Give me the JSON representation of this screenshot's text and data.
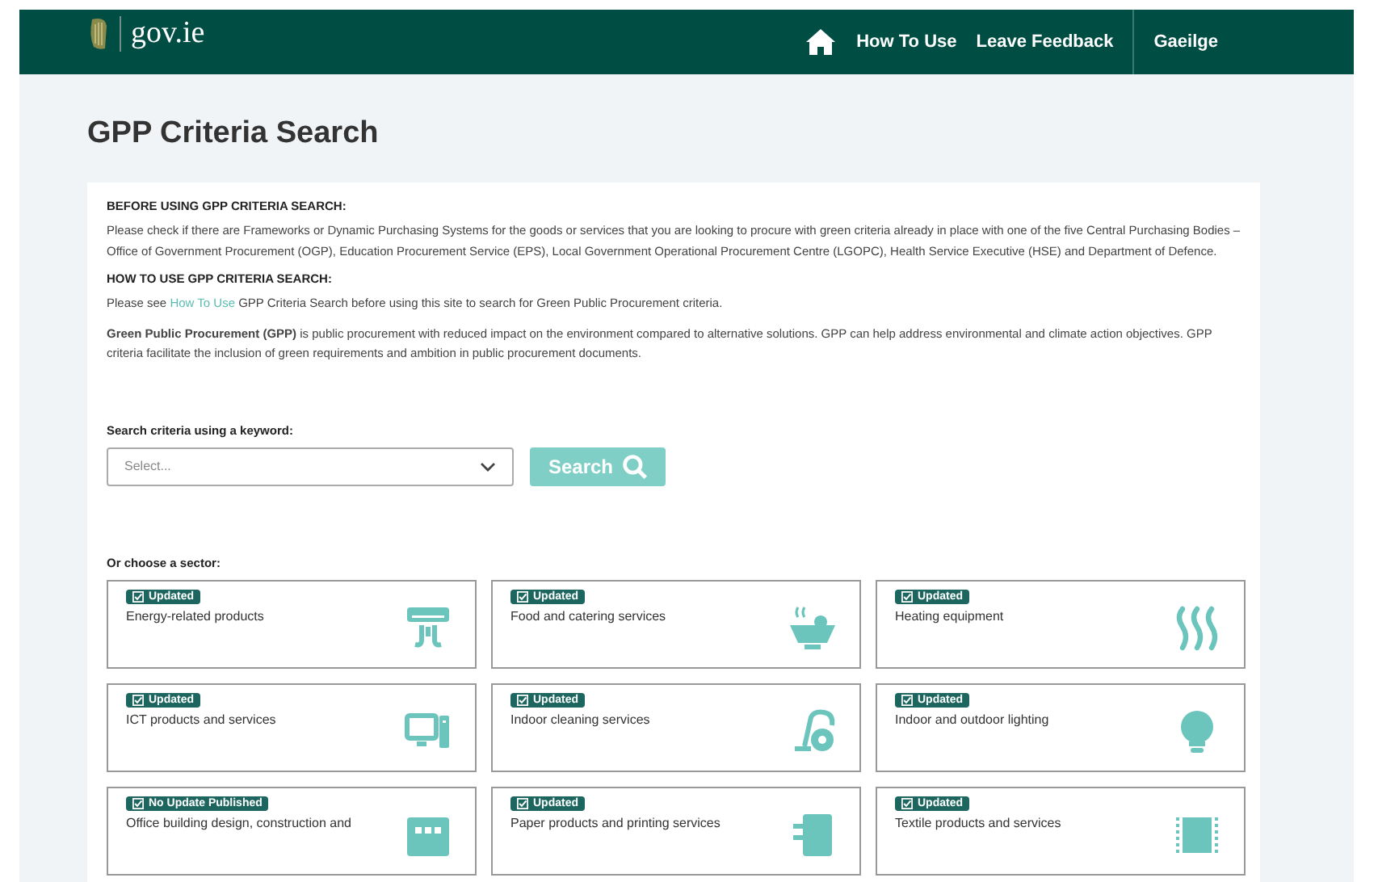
{
  "header": {
    "logo": "gov.ie",
    "nav": [
      "How To Use",
      "Leave Feedback"
    ],
    "language": "Gaeilge"
  },
  "page_title": "GPP Criteria Search",
  "intro": {
    "heading_1": "BEFORE USING GPP CRITERIA SEARCH:",
    "paragraph_1": "Please check if there are Frameworks or Dynamic Purchasing Systems for the goods or services that you are looking to procure with green criteria already in place with one of the five Central Purchasing Bodies – Office of Government Procurement (OGP), Education Procurement Service (EPS), Local Government Operational Procurement Centre (LGOPC), Health Service Executive (HSE) and Department of Defence.",
    "heading_2": "HOW TO USE GPP CRITERIA SEARCH:",
    "paragraph_2": {
      "before": "Please see ",
      "link": "How To Use",
      "after": " GPP Criteria Search before using this site to search for Green Public Procurement criteria."
    },
    "paragraph_3": "**Green Public Procurement (GPP)** is public procurement with reduced impact on the environment compared to alternative solutions. GPP can help address environmental and climate action objectives. GPP criteria facilitate the inclusion of green requirements and ambition in public procurement documents."
  },
  "search": {
    "label": "Search criteria using a keyword:",
    "placeholder": "Select...",
    "button": "Search",
    "disabled": true
  },
  "sectors_label": "Or choose a sector:",
  "sectors": [
    {
      "badge": "Updated",
      "name": "Energy-related products"
    },
    {
      "badge": "Updated",
      "name": "Food and catering services"
    },
    {
      "badge": "Updated",
      "name": "Heating equipment"
    },
    {
      "badge": "Updated",
      "name": "ICT products and services"
    },
    {
      "badge": "Updated",
      "name": "Indoor cleaning services"
    },
    {
      "badge": "Updated",
      "name": "Indoor and outdoor lighting"
    },
    {
      "badge": "No Update Published",
      "name": "Office building design, construction and"
    },
    {
      "badge": "Updated",
      "name": "Paper products and printing services"
    },
    {
      "badge": "Updated",
      "name": "Textile products and services"
    }
  ]
}
